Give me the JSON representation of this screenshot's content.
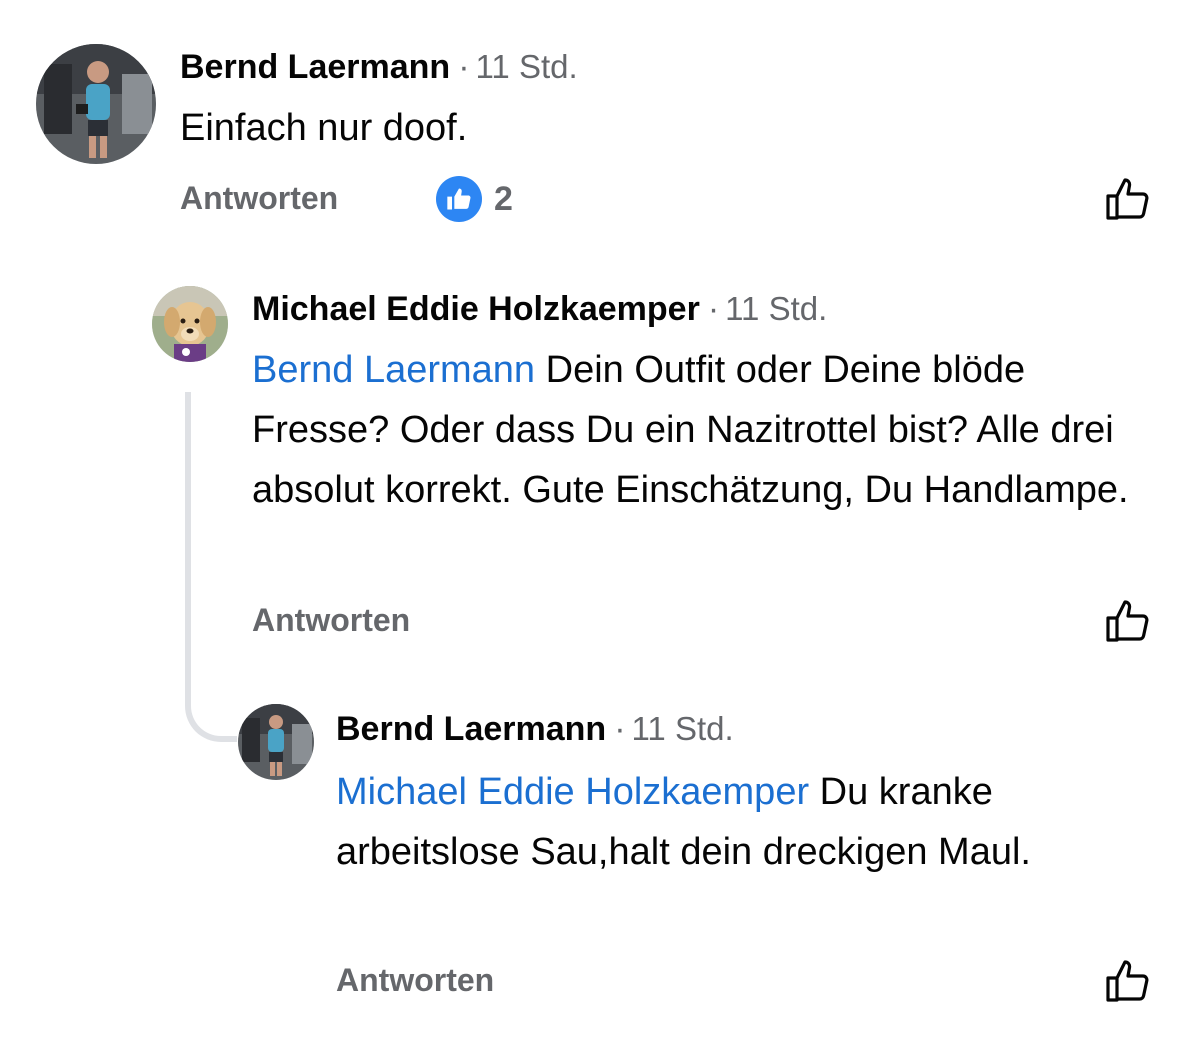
{
  "comments": [
    {
      "author": "Bernd Laermann",
      "separator": "·",
      "time": "11 Std.",
      "text": "Einfach nur doof.",
      "reply_label": "Antworten",
      "reaction_count": "2"
    },
    {
      "author": "Michael Eddie Holzkaemper",
      "separator": "·",
      "time": "11 Std.",
      "mention": "Bernd Laermann",
      "text": " Dein Outfit oder Deine blöde Fresse? Oder dass Du ein Nazitrottel bist? Alle drei absolut korrekt. Gute Einschätzung, Du Handlampe.",
      "reply_label": "Antworten"
    },
    {
      "author": "Bernd Laermann",
      "separator": "·",
      "time": "11 Std.",
      "mention": "Michael Eddie Holzkaemper",
      "text": " Du kranke arbeitslose Sau,halt dein dreckigen Maul.",
      "reply_label": "Antworten"
    }
  ],
  "colors": {
    "mention": "#1b6fd1",
    "meta": "#65676b",
    "like_badge": "#2d86f3",
    "thread_line": "#dfe1e5"
  },
  "icons": {
    "reaction": "thumbs-up-icon",
    "like_button": "thumbs-up-outline-icon"
  }
}
